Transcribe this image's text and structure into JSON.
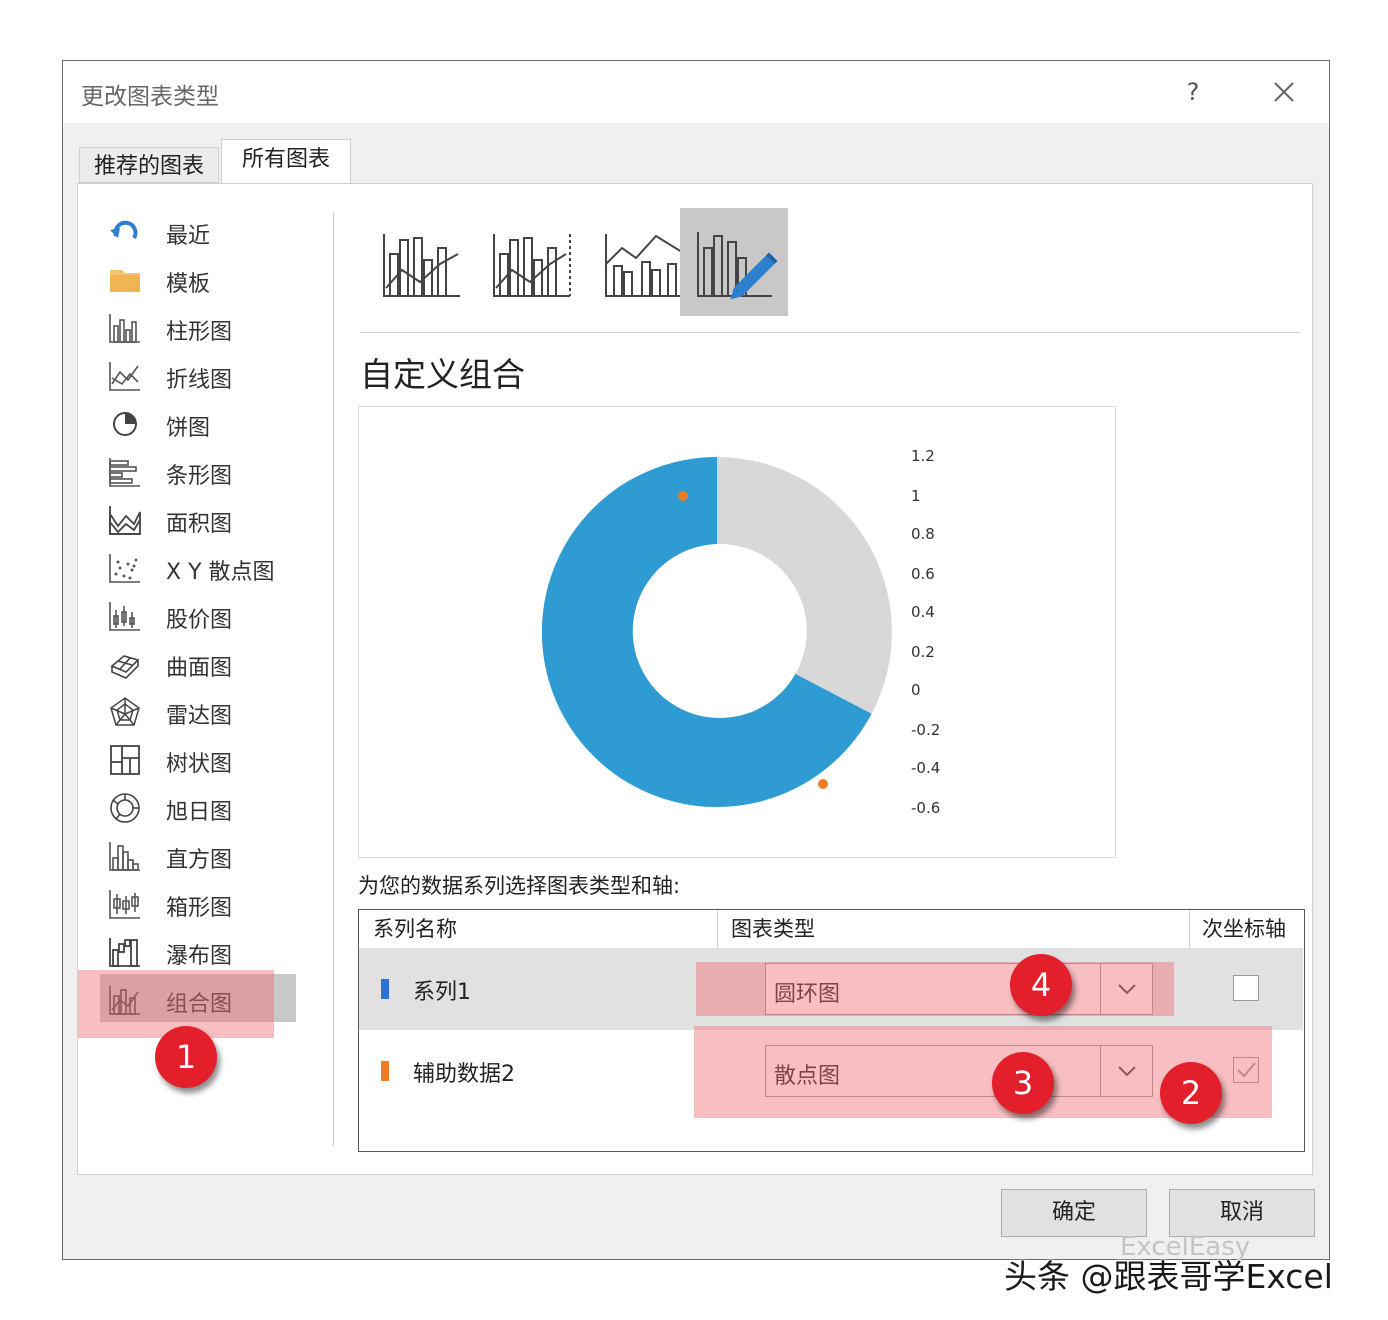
{
  "dialog": {
    "title": "更改图表类型",
    "help_label": "?",
    "tabs": [
      {
        "label": "推荐的图表",
        "selected": false
      },
      {
        "label": "所有图表",
        "selected": true
      }
    ],
    "sidebar": {
      "items": [
        {
          "label": "最近",
          "icon": "recent-icon"
        },
        {
          "label": "模板",
          "icon": "folder-icon"
        },
        {
          "label": "柱形图",
          "icon": "column-chart-icon"
        },
        {
          "label": "折线图",
          "icon": "line-chart-icon"
        },
        {
          "label": "饼图",
          "icon": "pie-chart-icon"
        },
        {
          "label": "条形图",
          "icon": "bar-chart-icon"
        },
        {
          "label": "面积图",
          "icon": "area-chart-icon"
        },
        {
          "label": "X Y 散点图",
          "icon": "scatter-chart-icon"
        },
        {
          "label": "股价图",
          "icon": "stock-chart-icon"
        },
        {
          "label": "曲面图",
          "icon": "surface-chart-icon"
        },
        {
          "label": "雷达图",
          "icon": "radar-chart-icon"
        },
        {
          "label": "树状图",
          "icon": "treemap-chart-icon"
        },
        {
          "label": "旭日图",
          "icon": "sunburst-chart-icon"
        },
        {
          "label": "直方图",
          "icon": "histogram-chart-icon"
        },
        {
          "label": "箱形图",
          "icon": "box-chart-icon"
        },
        {
          "label": "瀑布图",
          "icon": "waterfall-chart-icon"
        },
        {
          "label": "组合图",
          "icon": "combo-chart-icon",
          "selected": true
        }
      ]
    },
    "combo_types": [
      {
        "icon": "clustered-column-line-icon",
        "selected": false
      },
      {
        "icon": "clustered-column-line-secondary-axis-icon",
        "selected": false
      },
      {
        "icon": "stacked-area-clustered-column-icon",
        "selected": false
      },
      {
        "icon": "custom-combination-icon",
        "selected": true
      }
    ],
    "combo_title": "自定义组合",
    "preview": {
      "colors": {
        "blue": "#2e9bd3",
        "gray": "#d8d8d8",
        "orange": "#f07d21"
      },
      "axis_ticks": [
        "1.2",
        "1",
        "0.8",
        "0.6",
        "0.4",
        "0.2",
        "0",
        "-0.2",
        "-0.4",
        "-0.6"
      ]
    },
    "series_prompt": "为您的数据系列选择图表类型和轴:",
    "table": {
      "headers": {
        "name": "系列名称",
        "type": "图表类型",
        "secondary": "次坐标轴"
      },
      "rows": [
        {
          "name": "系列1",
          "color": "#2f6fd6",
          "chart_type": "圆环图",
          "secondary_axis": false
        },
        {
          "name": "辅助数据2",
          "color": "#f07d21",
          "chart_type": "散点图",
          "secondary_axis": true
        }
      ]
    },
    "buttons": {
      "ok": "确定",
      "cancel": "取消"
    }
  },
  "annotations": {
    "badges": [
      "1",
      "2",
      "3",
      "4"
    ],
    "badge_color": "#e31f2b"
  },
  "watermark": "头条 @跟表哥学Excel",
  "watermark_faint": "ExcelEasy"
}
